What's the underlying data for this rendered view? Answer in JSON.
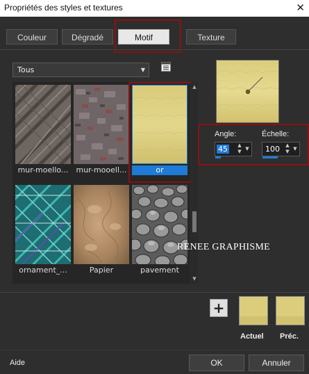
{
  "window": {
    "title": "Propriétés des styles et textures",
    "close_icon": "close-icon"
  },
  "tabs": [
    {
      "label": "Couleur",
      "active": false
    },
    {
      "label": "Dégradé",
      "active": false
    },
    {
      "label": "Motif",
      "active": true
    },
    {
      "label": "Texture",
      "active": false
    }
  ],
  "category": {
    "selected": "Tous"
  },
  "patterns": [
    {
      "label": "mur-moello...",
      "selected": false
    },
    {
      "label": "mur-mooell...",
      "selected": false
    },
    {
      "label": "or",
      "selected": true
    },
    {
      "label": "ornament_...",
      "selected": false
    },
    {
      "label": "Papier",
      "selected": false
    },
    {
      "label": "pavement",
      "selected": false
    }
  ],
  "controls": {
    "angle_label": "Angle:",
    "angle_value": "45",
    "scale_label": "Échelle:",
    "scale_value": "100"
  },
  "swatches": {
    "current_label": "Actuel",
    "previous_label": "Préc."
  },
  "watermark": "RENEE GRAPHISME",
  "footer": {
    "help_label": "Aide",
    "ok_label": "OK",
    "cancel_label": "Annuler"
  },
  "colors": {
    "selection": "#1e7bd6",
    "highlight_box": "#8b1212",
    "gold": "#d8c772"
  }
}
